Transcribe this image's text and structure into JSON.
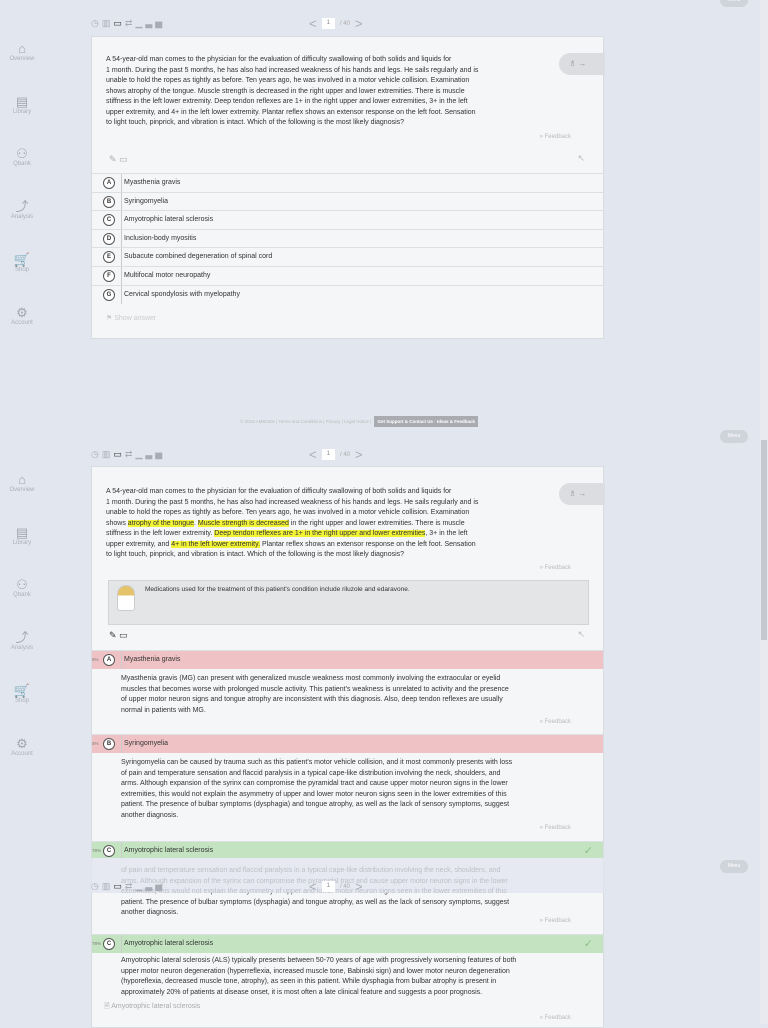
{
  "menu_label": "Menu",
  "sidebar": [
    {
      "label": "Overview",
      "icon": "⌂"
    },
    {
      "label": "Library",
      "icon": "▤"
    },
    {
      "label": "Qbank",
      "icon": "⚇"
    },
    {
      "label": "Analysis",
      "icon": "⤴"
    },
    {
      "label": "Shop",
      "icon": "🛒"
    },
    {
      "label": "Account",
      "icon": "⚙"
    }
  ],
  "toolbar": {
    "icons": [
      "clock-icon",
      "grid-icon",
      "comment-icon",
      "compare-icon",
      "stats-icon"
    ],
    "page": "1",
    "total": "/ 40"
  },
  "question_lines": [
    "A 54-year-old man comes to the physician for the evaluation of difficulty swallowing of both solids and liquids for",
    "1 month. During the past 5 months, he has also had increased weakness of his hands and legs. He sails regularly and is",
    "unable to hold the ropes as tightly as before. Ten years ago, he was involved in a motor vehicle collision. Examination",
    "shows atrophy of the tongue. Muscle strength is decreased in the right upper and lower extremities. There is muscle",
    "stiffness in the left lower extremity. Deep tendon reflexes are 1+ in the right upper and lower extremities, 3+ in the left",
    "upper extremity, and 4+ in the left lower extremity. Plantar reflex shows an extensor response on the left foot. Sensation",
    "to light touch, pinprick, and vibration is intact. Which of the following is the most likely diagnosis?"
  ],
  "highlighted_lines": [
    [
      [
        "A 54-year-old man comes to the physician for the evaluation of difficulty swallowing of both solids and liquids for",
        false
      ]
    ],
    [
      [
        "1 month. During the past 5 months, he has also had increased weakness of his hands and legs. He sails regularly and is",
        false
      ]
    ],
    [
      [
        "unable to hold the ropes as tightly as before. Ten years ago, he was involved in a motor vehicle collision. Examination",
        false
      ]
    ],
    [
      [
        "shows ",
        false
      ],
      [
        "atrophy of the tongue",
        true
      ],
      [
        ". ",
        false
      ],
      [
        "Muscle strength is decreased",
        true
      ],
      [
        " in the right upper and lower extremities. There is muscle",
        false
      ]
    ],
    [
      [
        "stiffness in the left lower extremity. ",
        false
      ],
      [
        "Deep tendon reflexes are 1+ in the right upper and lower extremities",
        true
      ],
      [
        ", 3+ in the left",
        false
      ]
    ],
    [
      [
        "upper extremity, and ",
        false
      ],
      [
        "4+ in the left lower extremity.",
        true
      ],
      [
        " Plantar reflex shows an extensor response on the left foot. Sensation",
        false
      ]
    ],
    [
      [
        "to light touch, pinprick, and vibration is intact. Which of the following is the most likely diagnosis?",
        false
      ]
    ]
  ],
  "feedback_label": "» Feedback",
  "show_answer": "Show answer",
  "hint": "Medications used for the treatment of this patient's condition include riluzole and edaravone.",
  "options": [
    {
      "letter": "A",
      "text": "Myasthenia gravis",
      "pct": "5%"
    },
    {
      "letter": "B",
      "text": "Syringomyelia",
      "pct": "4%"
    },
    {
      "letter": "C",
      "text": "Amyotrophic lateral sclerosis",
      "pct": "78%"
    },
    {
      "letter": "D",
      "text": "Inclusion-body myositis"
    },
    {
      "letter": "E",
      "text": "Subacute combined degeneration of spinal cord"
    },
    {
      "letter": "F",
      "text": "Multifocal motor neuropathy"
    },
    {
      "letter": "G",
      "text": "Cervical spondylosis with myelopathy"
    }
  ],
  "explanations": {
    "A": [
      "Myasthenia gravis (MG) can present with generalized muscle weakness most commonly involving the extraocular or eyelid",
      "muscles that becomes worse with prolonged muscle activity. This patient's weakness is unrelated to activity and the presence",
      "of upper motor neuron signs and tongue atrophy are inconsistent with this diagnosis. Also, deep tendon reflexes are usually",
      "normal in patients with MG."
    ],
    "B": [
      "Syringomyelia can be caused by trauma such as this patient's motor vehicle collision, and it most commonly presents with loss",
      "of pain and temperature sensation and flaccid paralysis in a typical cape-like distribution involving the neck, shoulders, and",
      "arms. Although expansion of the syrinx can compromise the pyramidal tract and cause upper motor neuron signs in the lower",
      "extremities, this would not explain the asymmetry of upper and lower motor neuron signs seen in the lower extremities of this",
      "patient. The presence of bulbar symptoms (dysphagia) and tongue atrophy, as well as the lack of sensory symptoms, suggest",
      "another diagnosis."
    ],
    "C": [
      "Amyotrophic lateral sclerosis (ALS) typically presents between 50-70 years of age with progressively worsening features of both",
      "upper motor neuron degeneration (hyperreflexia, increased muscle tone, Babinski sign) and lower motor neuron degeneration",
      "(hyporeflexia, decreased muscle tone, atrophy), as seen in this patient. While dysphagia from bulbar atrophy is present in",
      "approximately 20% of patients at disease onset, it is most often a late clinical feature and suggests a poor prognosis."
    ]
  },
  "library_link": "Amyotrophic lateral sclerosis",
  "footer": {
    "text": "© 2019 AMBOSS | Terms and Conditions | Privacy | Legal Notice |",
    "support": "Get Support & Contact Us · Ideas & Feedback"
  },
  "colors": {
    "background": "#e2e6ee",
    "wrong": "#efc3c5",
    "correct": "#c4e4c1",
    "highlight": "#f3f336"
  }
}
